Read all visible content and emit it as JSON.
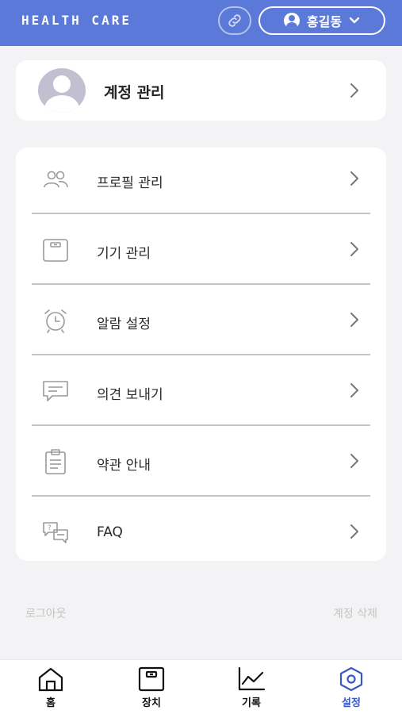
{
  "header": {
    "brand": "HEALTH CARE",
    "user_name": "홍길동",
    "bg_color": "#5a79d9"
  },
  "account": {
    "title": "계정 관리"
  },
  "menu": {
    "items": [
      {
        "label": "프로필 관리",
        "icon": "people-icon"
      },
      {
        "label": "기기 관리",
        "icon": "scale-icon"
      },
      {
        "label": "알람 설정",
        "icon": "alarm-clock-icon"
      },
      {
        "label": "의견 보내기",
        "icon": "chat-bubble-icon"
      },
      {
        "label": "약관 안내",
        "icon": "clipboard-icon"
      },
      {
        "label": "FAQ",
        "icon": "faq-chat-icon"
      }
    ]
  },
  "footer_links": {
    "logout": "로그아웃",
    "delete_account": "계정 삭제"
  },
  "bottom_nav": {
    "items": [
      {
        "label": "홈",
        "icon": "home-icon",
        "active": false
      },
      {
        "label": "장치",
        "icon": "device-scale-icon",
        "active": false
      },
      {
        "label": "기록",
        "icon": "chart-icon",
        "active": false
      },
      {
        "label": "설정",
        "icon": "settings-hex-icon",
        "active": true
      }
    ],
    "active_color": "#3a57c8"
  }
}
